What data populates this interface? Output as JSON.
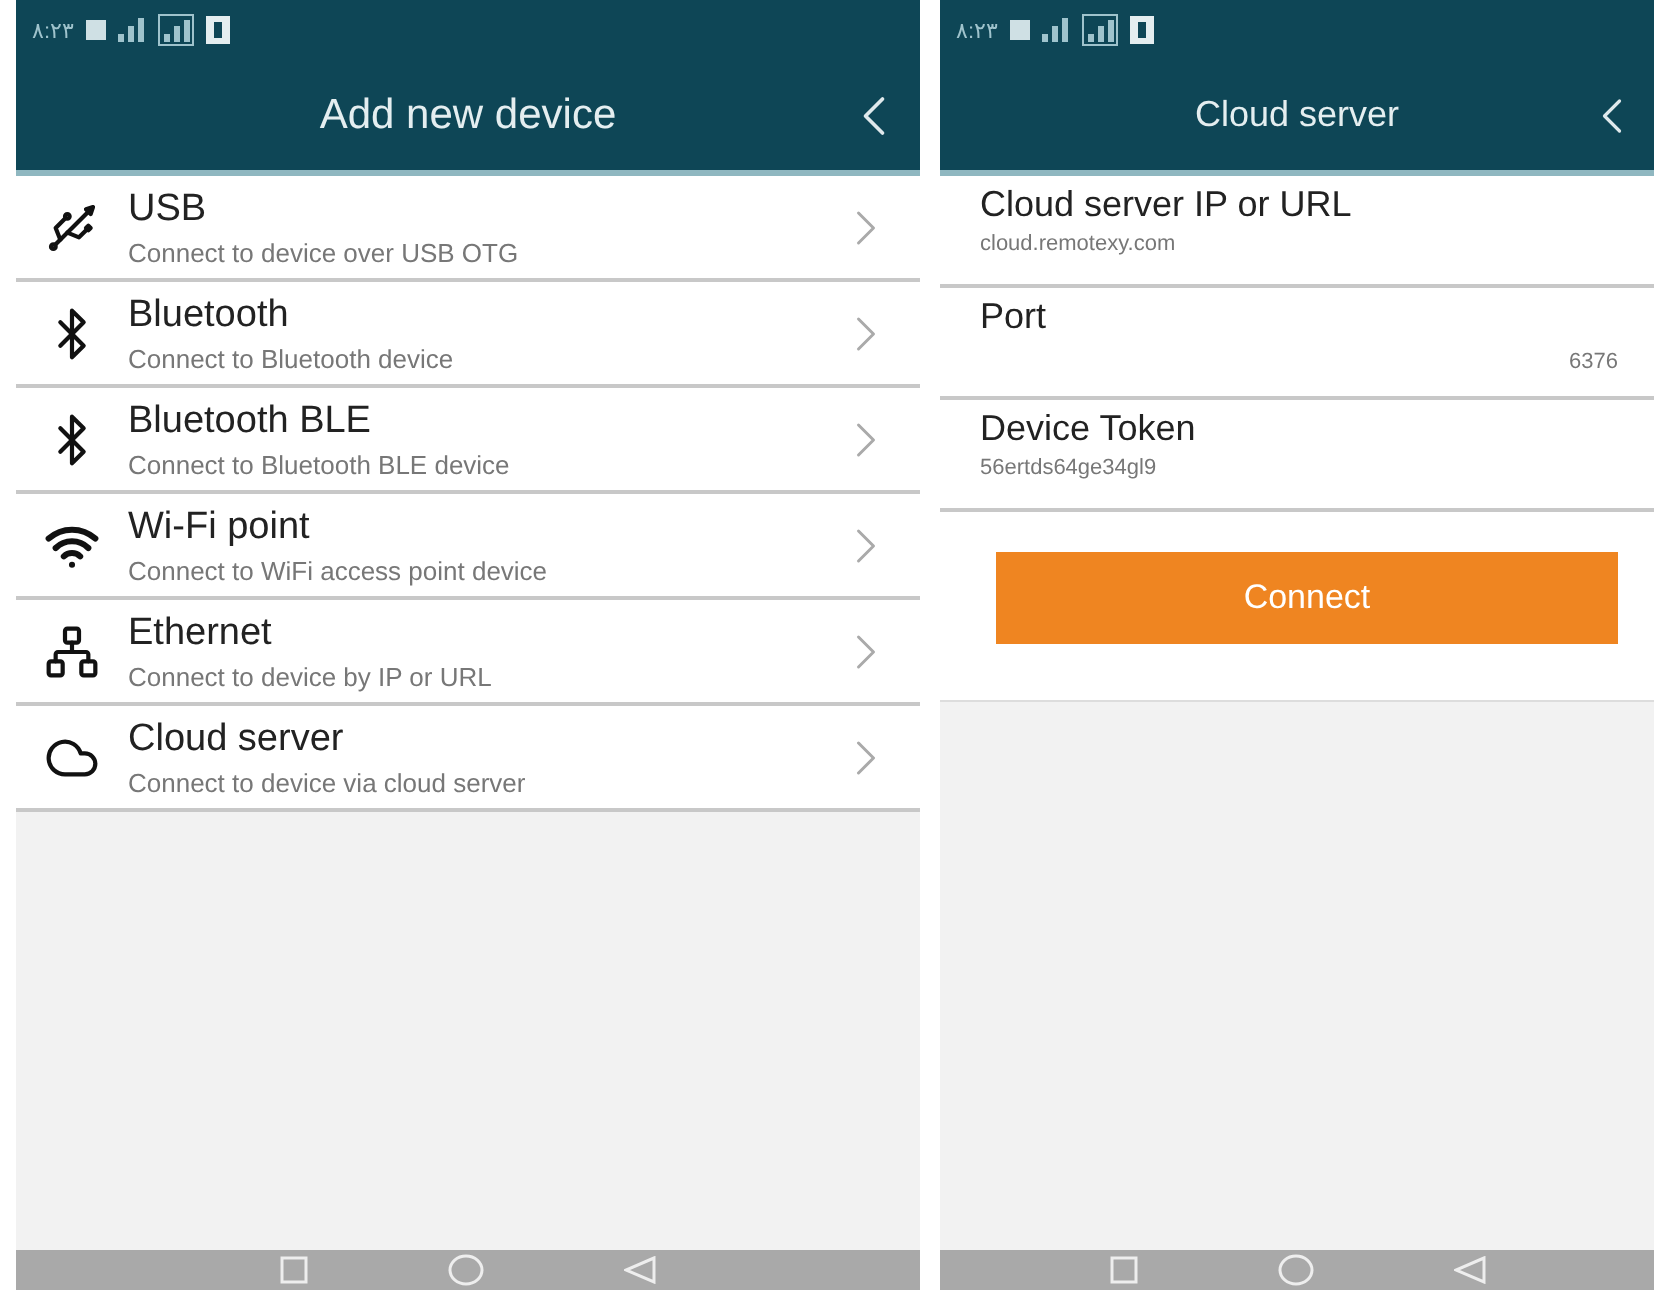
{
  "add_device_screen": {
    "status_bar": {
      "time": "٨:٢٣"
    },
    "title": "Add new device",
    "devices": [
      {
        "kind": "usb",
        "name": "USB",
        "description": "Connect to device over USB OTG"
      },
      {
        "kind": "bluetooth",
        "name": "Bluetooth",
        "description": "Connect to Bluetooth device"
      },
      {
        "kind": "bluetooth",
        "name": "Bluetooth BLE",
        "description": "Connect to Bluetooth BLE device"
      },
      {
        "kind": "wifi",
        "name": "Wi-Fi point",
        "description": "Connect to WiFi access point device"
      },
      {
        "kind": "ethernet",
        "name": "Ethernet",
        "description": "Connect to device by IP or URL"
      },
      {
        "kind": "cloud",
        "name": "Cloud server",
        "description": "Connect to device via cloud server"
      }
    ]
  },
  "cloud_server_screen": {
    "status_bar": {
      "time": "٨:٢٣"
    },
    "title": "Cloud server",
    "fields": [
      {
        "kind": "text",
        "label": "Cloud server IP or URL",
        "value": "cloud.remotexy.com"
      },
      {
        "kind": "number",
        "label": "Port",
        "value": "6376"
      },
      {
        "kind": "text",
        "label": "Device Token",
        "value": "56ertds64ge34gl9"
      }
    ],
    "button": "Connect"
  }
}
